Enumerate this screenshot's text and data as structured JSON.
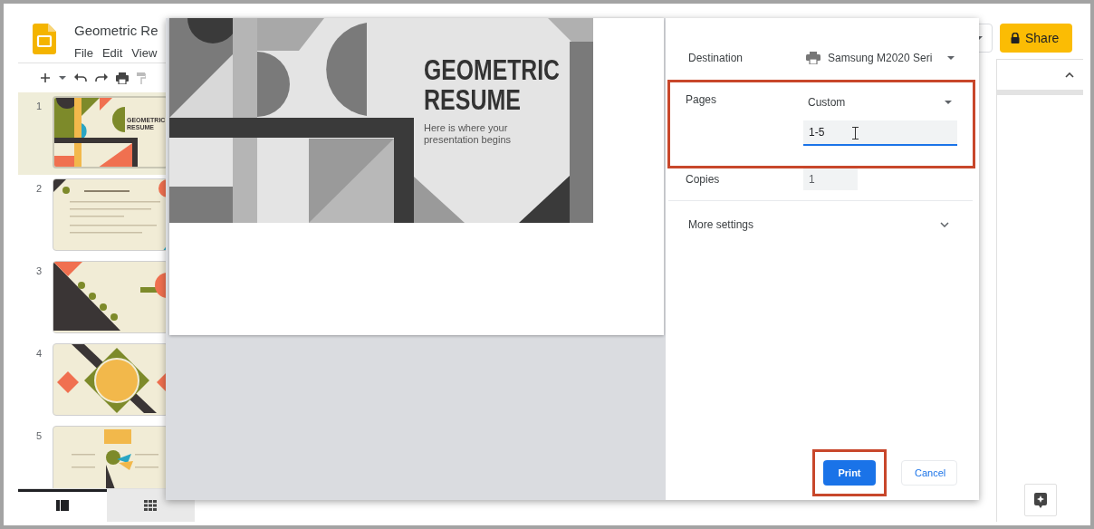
{
  "app": {
    "title": "Geometric Re",
    "menu": [
      "File",
      "Edit",
      "View"
    ],
    "share_button": "Share"
  },
  "slides": [
    {
      "number": "1",
      "selected": true,
      "kind": "title",
      "title_lines": [
        "GEOMETRIC",
        "RESUME"
      ]
    },
    {
      "number": "2",
      "selected": false,
      "kind": "contents"
    },
    {
      "number": "3",
      "selected": false,
      "kind": "agenda"
    },
    {
      "number": "4",
      "selected": false,
      "kind": "circle"
    },
    {
      "number": "5",
      "selected": false,
      "kind": "diagram"
    }
  ],
  "view_tabs": [
    {
      "kind": "filmstrip",
      "selected": true
    },
    {
      "kind": "grid",
      "selected": false
    }
  ],
  "print_dialog": {
    "preview": {
      "title_lines": [
        "GEOMETRIC",
        "RESUME"
      ],
      "subtitle_lines": [
        "Here is where your",
        "presentation begins"
      ]
    },
    "settings": [
      {
        "kind": "destination",
        "label": "Destination",
        "value": "Samsung M2020 Seri",
        "highlighted": false
      },
      {
        "kind": "pages",
        "label": "Pages",
        "value": "Custom",
        "input": "1-5",
        "focused": true,
        "highlighted": true
      },
      {
        "kind": "copies",
        "label": "Copies",
        "value": "1",
        "highlighted": false
      },
      {
        "kind": "expander",
        "label": "More settings",
        "expanded": false,
        "highlighted": false
      }
    ],
    "buttons": [
      {
        "label": "Print",
        "kind": "primary",
        "highlighted": true
      },
      {
        "label": "Cancel",
        "kind": "secondary",
        "highlighted": false
      }
    ]
  }
}
